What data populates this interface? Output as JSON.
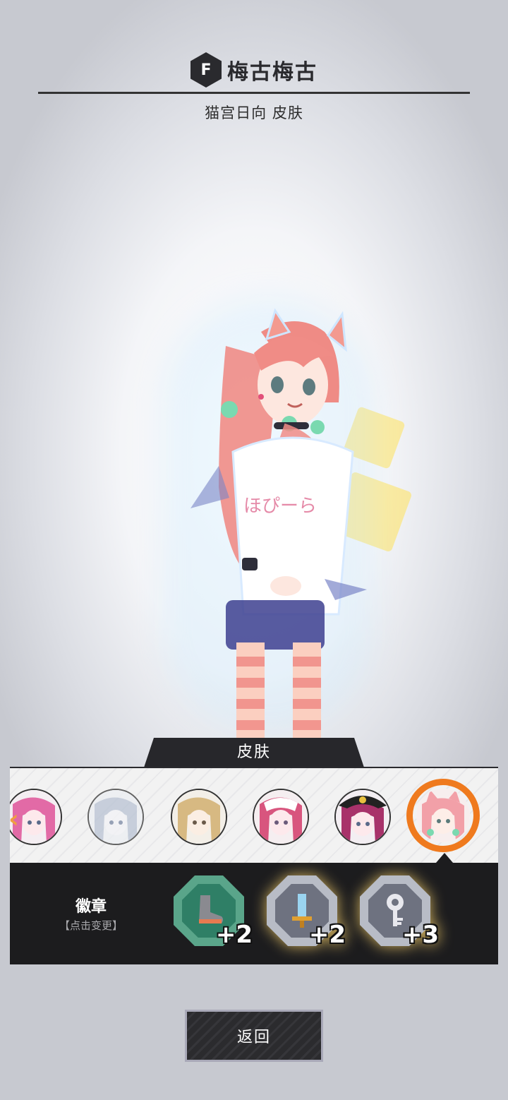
{
  "header": {
    "logo_glyph": "F",
    "title": "梅古梅古",
    "subtitle": "猫宫日向 皮肤"
  },
  "character": {
    "shirt_text": "ほぴーら",
    "hair_color": "#ef8c86"
  },
  "skin_panel": {
    "tab_label": "皮肤",
    "avatars": [
      {
        "name": "pink-hair-partial",
        "hair": "#e26aa6"
      },
      {
        "name": "blue-gray-hair",
        "hair": "#b9c3d4"
      },
      {
        "name": "blonde-hair",
        "hair": "#d7b982"
      },
      {
        "name": "pink-white-hair",
        "hair": "#d8557e"
      },
      {
        "name": "magenta-captain-hat",
        "hair": "#a8326a"
      },
      {
        "name": "pink-cat-ears-selected",
        "hair": "#f2a0a8"
      }
    ],
    "selected_index": 5,
    "accent": "#ef7a1e"
  },
  "badges": {
    "label": "徽章",
    "hint": "【点击变更】",
    "items": [
      {
        "icon": "boot-icon",
        "level": "+2",
        "style": "teal"
      },
      {
        "icon": "sword-icon",
        "level": "+2",
        "style": "silver"
      },
      {
        "icon": "key-icon",
        "level": "+3",
        "style": "silver"
      }
    ]
  },
  "footer": {
    "back_label": "返回"
  }
}
